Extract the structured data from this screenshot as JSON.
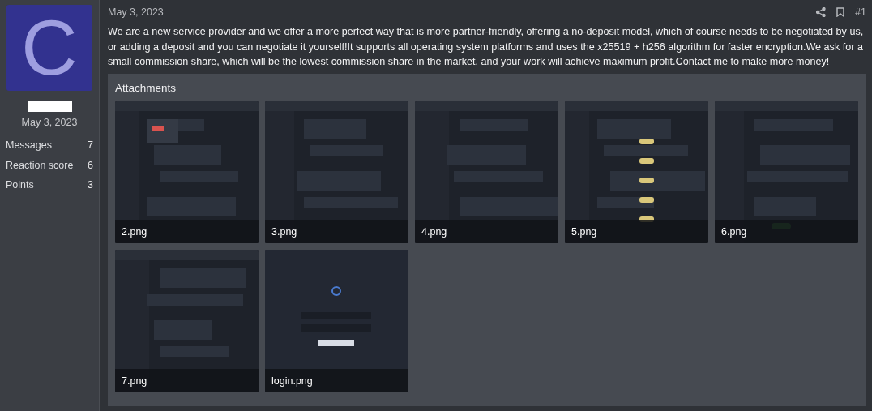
{
  "author": {
    "avatar_letter": "C",
    "joined": "May 3, 2023",
    "stats": [
      {
        "label": "Messages",
        "value": "7"
      },
      {
        "label": "Reaction score",
        "value": "6"
      },
      {
        "label": "Points",
        "value": "3"
      }
    ]
  },
  "post": {
    "date": "May 3, 2023",
    "number": "#1",
    "body": "We are a new service provider and we offer a more perfect way that is more partner-friendly, offering a no-deposit model, which of course needs to be negotiated by us, or adding a deposit and you can negotiate it yourself!It supports all operating system platforms and uses the x25519 + h256 algorithm for faster encryption.We ask for a small commission share, which will be the lowest commission share in the market, and your work will achieve maximum profit.Contact me to make more money!"
  },
  "attachments": {
    "title": "Attachments",
    "files": [
      {
        "name": "2.png"
      },
      {
        "name": "3.png"
      },
      {
        "name": "4.png"
      },
      {
        "name": "5.png"
      },
      {
        "name": "6.png"
      },
      {
        "name": "7.png"
      },
      {
        "name": "login.png"
      }
    ]
  }
}
